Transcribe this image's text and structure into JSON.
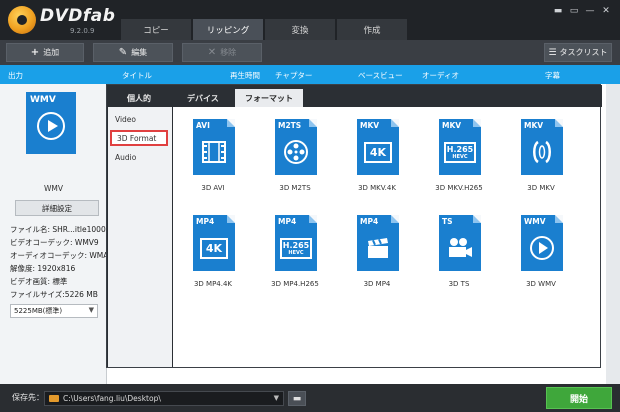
{
  "app": {
    "brand": "DVDfab",
    "version": "9.2.0.9"
  },
  "tabs": [
    {
      "label": "コピー"
    },
    {
      "label": "リッピング"
    },
    {
      "label": "変換"
    },
    {
      "label": "作成"
    }
  ],
  "window_buttons": [
    "▬",
    "▭",
    "—",
    "✕"
  ],
  "toolbar": {
    "add_icon": "+",
    "add_label": "追加",
    "edit_icon": "✎",
    "edit_label": "編集",
    "remove_icon": "✕",
    "remove_label": "移除",
    "tasklist_icon": "☰",
    "tasklist_label": "タスクリスト"
  },
  "header": {
    "output": "出力",
    "title": "タイトル",
    "duration": "再生時間",
    "chapter": "チャプター",
    "preview": "ベースビュー",
    "audio": "オーディオ",
    "subtitle": "字幕"
  },
  "left_panel": {
    "icon_label": "WMV",
    "profile_name": "WMV",
    "detail_button": "詳細設定",
    "info": [
      "ファイル名: SHR...itle1000",
      "ビデオコーデック: WMV9",
      "オーディオコーデック: WMA",
      "解像度: 1920x816",
      "ビデオ画質: 標準",
      "ファイルサイズ:5226 MB"
    ],
    "size_select": "5225MB(標準)"
  },
  "popup": {
    "subtabs": [
      "個人的",
      "デバイス",
      "フォーマット"
    ],
    "categories": [
      "Video",
      "3D Format",
      "Audio"
    ],
    "formats": [
      {
        "tag": "AVI",
        "glyph": "film",
        "label": "3D AVI"
      },
      {
        "tag": "M2TS",
        "glyph": "reel",
        "label": "3D M2TS"
      },
      {
        "tag": "MKV",
        "glyph": "4k",
        "label": "3D MKV.4K"
      },
      {
        "tag": "MKV",
        "glyph": "h265",
        "label": "3D MKV.H265"
      },
      {
        "tag": "MKV",
        "glyph": "mkv",
        "label": "3D MKV"
      },
      {
        "tag": "MP4",
        "glyph": "4k",
        "label": "3D MP4.4K"
      },
      {
        "tag": "MP4",
        "glyph": "h265",
        "label": "3D MP4.H265"
      },
      {
        "tag": "MP4",
        "glyph": "clap",
        "label": "3D MP4"
      },
      {
        "tag": "TS",
        "glyph": "camera",
        "label": "3D TS"
      },
      {
        "tag": "WMV",
        "glyph": "play",
        "label": "3D WMV"
      }
    ],
    "glyph_text": {
      "k4": "4K",
      "h265_main": "H.265",
      "h265_sub": "HEVC"
    }
  },
  "bottom": {
    "save_label": "保存先：",
    "path": "C:\\Users\\fang.liu\\Desktop\\",
    "path_arrow": "▼",
    "browse_icon": "▬",
    "start_label": "開始"
  },
  "colors": {
    "accent": "#1aa0e8",
    "icon_blue": "#1a7fcf",
    "start_green": "#3fa73b",
    "highlight_red": "#e04040"
  }
}
